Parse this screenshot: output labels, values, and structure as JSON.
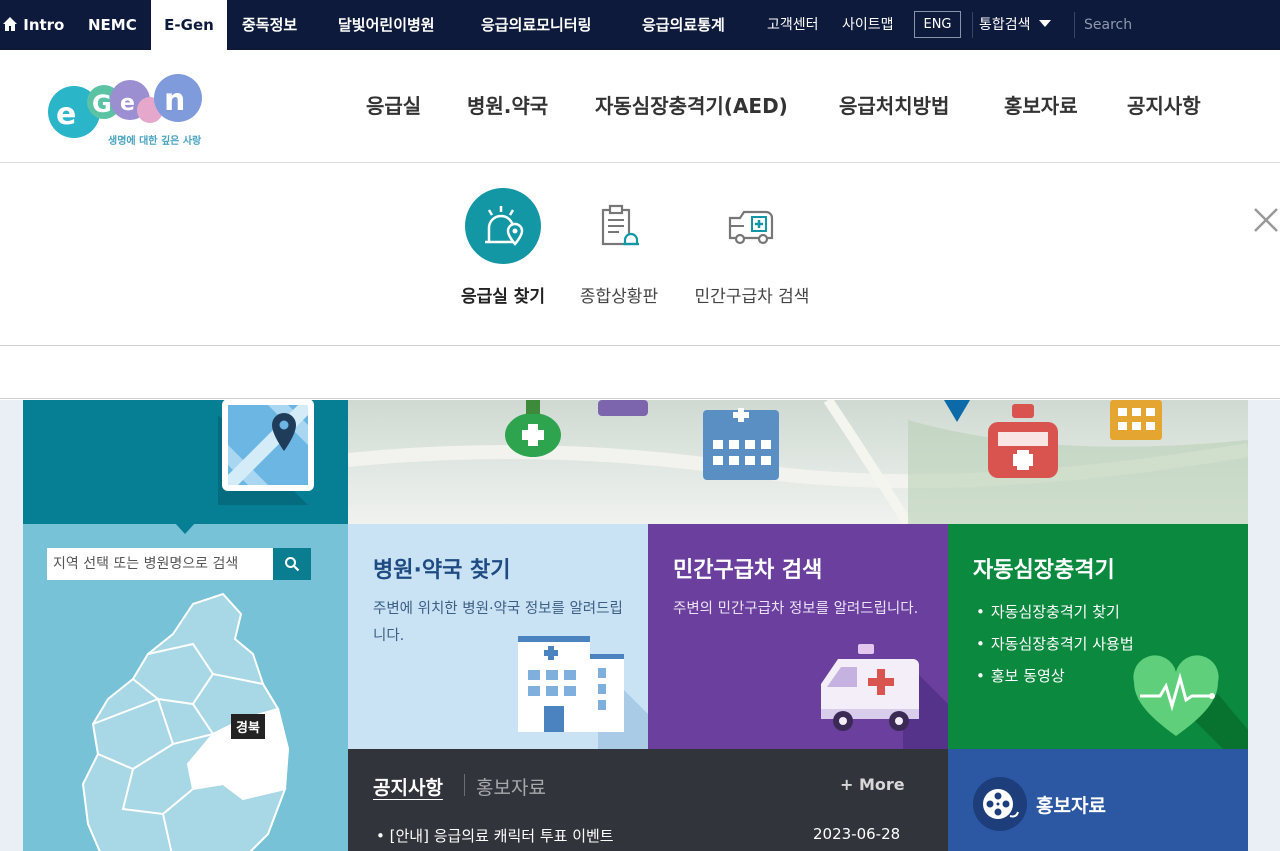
{
  "topbar": {
    "home_label": "Intro",
    "tabs": [
      {
        "label": "NEMC"
      },
      {
        "label": "E-Gen"
      },
      {
        "label": "중독정보"
      },
      {
        "label": "달빛어린이병원"
      },
      {
        "label": "응급의료모니터링"
      },
      {
        "label": "응급의료통계"
      }
    ],
    "util": {
      "customer_center": "고객센터",
      "sitemap": "사이트맵",
      "eng": "ENG",
      "integrated_search": "통합검색",
      "search_placeholder": "Search"
    }
  },
  "header": {
    "logo_tagline": "생명에 대한 깊은 사랑",
    "nav": [
      {
        "label": "응급실"
      },
      {
        "label": "병원.약국"
      },
      {
        "label": "자동심장충격기(AED)"
      },
      {
        "label": "응급처치방법"
      },
      {
        "label": "홍보자료"
      },
      {
        "label": "공지사항"
      }
    ]
  },
  "submenu": {
    "items": [
      {
        "label": "응급실 찾기",
        "icon": "emergency-room-icon",
        "active": true
      },
      {
        "label": "종합상황판",
        "icon": "status-board-icon",
        "active": false
      },
      {
        "label": "민간구급차 검색",
        "icon": "ambulance-icon",
        "active": false
      }
    ]
  },
  "er_search": {
    "placeholder": "지역 선택 또는 병원명으로 검색",
    "region_label": "경북"
  },
  "cards": {
    "hospital": {
      "title": "병원·약국 찾기",
      "desc": "주변에 위치한 병원·약국 정보를 알려드립니다."
    },
    "ambulance": {
      "title": "민간구급차 검색",
      "desc": "주변의 민간구급차 정보를 알려드립니다."
    },
    "aed": {
      "title": "자동심장충격기",
      "items": [
        "자동심장충격기 찾기",
        "자동심장충격기 사용법",
        "홍보 동영상"
      ]
    }
  },
  "notice": {
    "tab_active": "공지사항",
    "tab_inactive": "홍보자료",
    "more": "+ More",
    "item": "• [안내] 응급의료 캐릭터 투표 이벤트",
    "date": "2023-06-28"
  },
  "promo": {
    "label": "홍보자료"
  },
  "colors": {
    "topbar_bg": "#0d1a3c",
    "accent_teal": "#1497a5",
    "card_hospital": "#c9e2f4",
    "card_ambulance": "#6a3f9e",
    "card_aed": "#0b8a3f",
    "notice_bg": "#31343a",
    "promo_bg": "#2c58a3"
  }
}
